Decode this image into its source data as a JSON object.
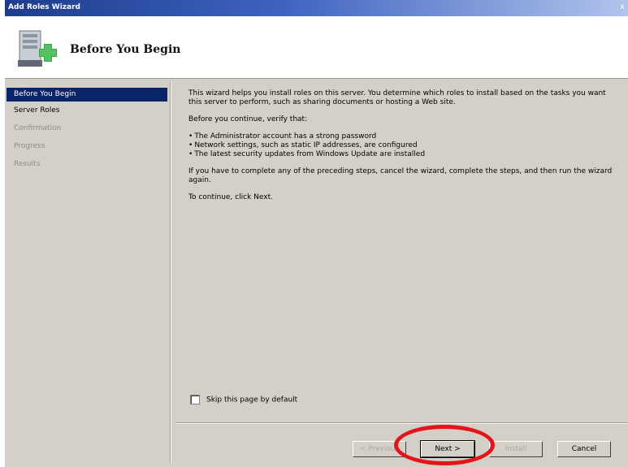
{
  "window": {
    "title": "Add Roles Wizard",
    "close_glyph": "x",
    "accent_color": "#0a246a"
  },
  "banner": {
    "icon": "server-add-icon",
    "heading": "Before You Begin"
  },
  "nav": {
    "items": [
      {
        "label": "Before You Begin",
        "state": "active"
      },
      {
        "label": "Server Roles",
        "state": "enabled"
      },
      {
        "label": "Confirmation",
        "state": "disabled"
      },
      {
        "label": "Progress",
        "state": "disabled"
      },
      {
        "label": "Results",
        "state": "disabled"
      }
    ]
  },
  "content": {
    "intro": "This wizard helps you install roles on this server. You determine which roles to install based on the tasks you want this server to perform, such as sharing documents or hosting a Web site.",
    "verify_heading": "Before you continue, verify that:",
    "bullets": [
      "The Administrator account has a strong password",
      "Network settings, such as static IP addresses, are configured",
      "The latest security updates from Windows Update are installed"
    ],
    "complete_steps": "If you have to complete any of the preceding steps, cancel the wizard, complete the steps, and then run the wizard again.",
    "continue_text": "To continue, click Next."
  },
  "skip": {
    "label": "Skip this page by default",
    "checked": false
  },
  "buttons": {
    "previous": "< Previous",
    "next": "Next >",
    "install": "Install",
    "cancel": "Cancel"
  },
  "annotation": {
    "color": "#e3151a",
    "target": "next-button"
  }
}
